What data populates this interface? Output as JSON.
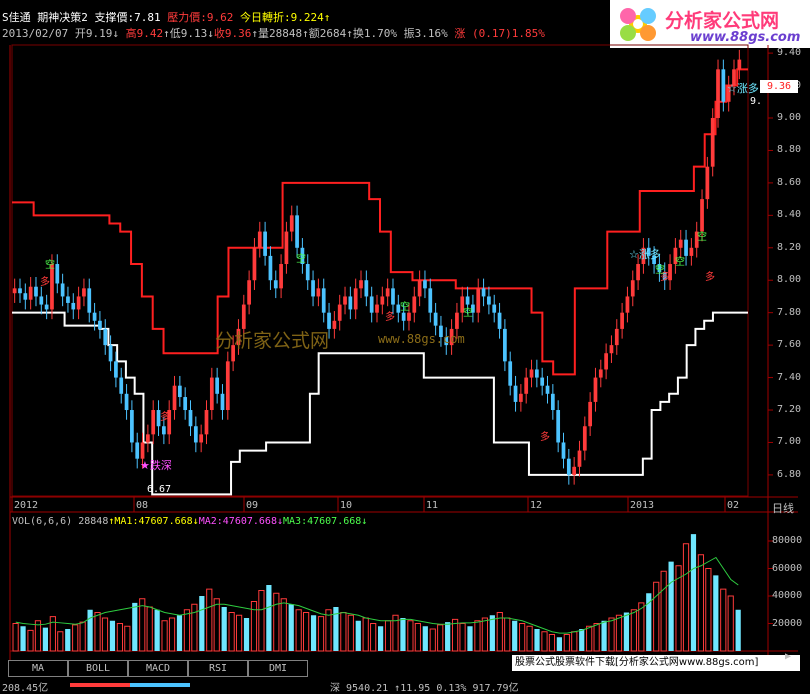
{
  "header": {
    "stock_name": "S佳通",
    "indicator": "期神决策2",
    "support_label": "支撑價:7.81",
    "pressure_label": "壓力價:9.62",
    "today_label": "今日轉折:9.224",
    "date": "2013/02/07",
    "open": "开9.19",
    "high": "高9.42",
    "low": "低9.13",
    "close": "收9.36",
    "volume": "量28848",
    "amount": "额2684",
    "turnover": "换1.70%",
    "amplitude": "振3.16%",
    "change": "涨 (0.17)1.85%"
  },
  "logo": {
    "title": "分析家公式网",
    "url": "www.88gs.com"
  },
  "watermark": {
    "title": "分析家公式网",
    "url": "www.88gs.com"
  },
  "price_axis": {
    "ticks": [
      "9.40",
      "9.20",
      "9.00",
      "8.80",
      "8.60",
      "8.40",
      "8.20",
      "8.00",
      "7.80",
      "7.60",
      "7.40",
      "7.20",
      "7.00",
      "6.80"
    ],
    "current_price": "9.36",
    "low_value": "6.67",
    "right_partial": "9."
  },
  "time_axis": {
    "labels": [
      "2012",
      "08",
      "09",
      "10",
      "11",
      "12",
      "2013",
      "02"
    ],
    "period": "日线"
  },
  "annotations": {
    "rise_label": "☆涨多",
    "fall_label": "★跌深",
    "buy_mark": "多",
    "sell_mark": "空"
  },
  "volume_header": {
    "name": "VOL(6,6,6)",
    "value": "28848",
    "ma1": "MA1:47607.668",
    "ma2": "MA2:47607.668",
    "ma3": "MA3:47607.668"
  },
  "volume_axis": {
    "ticks": [
      "80000",
      "60000",
      "40000",
      "20000"
    ]
  },
  "tabs": [
    "MA",
    "BOLL",
    "MACD",
    "RSI",
    "DMI"
  ],
  "banner": "股票公式股票软件下载[分析家公式网www.88gs.com]",
  "bottom_bar": {
    "left": "208.45亿",
    "middle": "深 9540.21 ↑11.95 0.13% 917.79亿"
  },
  "colors": {
    "up": "#ff3b3b",
    "down": "#4cc3ff",
    "support": "#ffffff",
    "pressure": "#ff2020",
    "ma": "#2ecc40"
  },
  "chart_data": {
    "type": "candlestick",
    "x_range": [
      "2012-07",
      "2013-02"
    ],
    "ylim": [
      6.67,
      9.45
    ],
    "close_series": [
      7.95,
      7.92,
      7.88,
      7.96,
      7.9,
      7.85,
      7.82,
      8.1,
      7.98,
      7.9,
      7.86,
      7.82,
      7.9,
      7.95,
      7.8,
      7.75,
      7.7,
      7.6,
      7.5,
      7.4,
      7.3,
      7.2,
      7.0,
      6.9,
      7.0,
      7.05,
      7.2,
      7.1,
      7.05,
      7.2,
      7.35,
      7.28,
      7.2,
      7.1,
      7.0,
      7.05,
      7.2,
      7.4,
      7.3,
      7.2,
      7.5,
      7.6,
      7.7,
      7.85,
      8.0,
      8.2,
      8.3,
      8.15,
      8.0,
      7.95,
      8.1,
      8.3,
      8.4,
      8.2,
      8.1,
      8.0,
      7.9,
      7.95,
      7.8,
      7.7,
      7.75,
      7.85,
      7.9,
      7.82,
      7.95,
      8.0,
      7.9,
      7.8,
      7.85,
      7.9,
      7.95,
      7.85,
      7.8,
      7.75,
      7.8,
      7.9,
      8.0,
      7.95,
      7.8,
      7.72,
      7.65,
      7.6,
      7.7,
      7.8,
      7.9,
      7.85,
      7.8,
      7.95,
      7.9,
      7.85,
      7.8,
      7.7,
      7.5,
      7.35,
      7.25,
      7.3,
      7.4,
      7.45,
      7.4,
      7.35,
      7.3,
      7.2,
      7.0,
      6.9,
      6.8,
      6.85,
      6.95,
      7.1,
      7.25,
      7.4,
      7.45,
      7.55,
      7.6,
      7.7,
      7.8,
      7.9,
      8.0,
      8.1,
      8.2,
      8.15,
      8.1,
      8.05,
      8.0,
      8.1,
      8.2,
      8.25,
      8.15,
      8.2,
      8.3,
      8.5,
      8.7,
      9.0,
      9.3,
      9.1,
      9.2,
      9.3,
      9.36
    ],
    "support_series": [
      7.8,
      7.8,
      7.8,
      7.8,
      7.8,
      7.8,
      7.72,
      7.72,
      7.72,
      7.72,
      7.7,
      7.6,
      7.5,
      7.4,
      7.3,
      7.0,
      6.68,
      6.68,
      6.68,
      6.68,
      6.68,
      6.68,
      6.68,
      6.68,
      6.68,
      6.88,
      6.95,
      6.95,
      6.95,
      7.0,
      7.0,
      7.0,
      7.0,
      7.0,
      7.3,
      7.55,
      7.55,
      7.55,
      7.55,
      7.55,
      7.55,
      7.55,
      7.55,
      7.55,
      7.55,
      7.55,
      7.55,
      7.4,
      7.4,
      7.4,
      7.4,
      7.4,
      7.4,
      7.4,
      7.4,
      7.0,
      7.0,
      7.0,
      7.0,
      6.8,
      6.8,
      6.8,
      6.8,
      6.8,
      6.8,
      6.8,
      6.8,
      6.8,
      6.8,
      6.8,
      6.8,
      6.8,
      6.9,
      7.2,
      7.25,
      7.3,
      7.4,
      7.6,
      7.7,
      7.75,
      7.8,
      7.8,
      7.8,
      7.8
    ],
    "pressure_series": [
      8.48,
      8.48,
      8.4,
      8.4,
      8.4,
      8.4,
      8.4,
      8.4,
      8.4,
      8.35,
      8.3,
      8.1,
      7.9,
      7.7,
      7.55,
      7.55,
      7.55,
      7.55,
      7.55,
      7.9,
      8.2,
      8.2,
      8.2,
      8.2,
      8.2,
      8.6,
      8.6,
      8.6,
      8.6,
      8.6,
      8.6,
      8.6,
      8.6,
      8.5,
      8.3,
      8.05,
      8.05,
      8.0,
      8.0,
      8.0,
      8.0,
      7.95,
      7.95,
      7.95,
      7.95,
      7.95,
      7.95,
      7.95,
      7.8,
      7.5,
      7.42,
      7.42,
      7.95,
      7.95,
      7.95,
      8.3,
      8.3,
      8.3,
      8.55,
      8.55,
      8.55,
      8.55,
      8.55,
      8.7,
      8.9,
      9.1,
      9.2,
      9.3
    ],
    "volume_series": [
      20000,
      18000,
      15000,
      22000,
      17000,
      25000,
      14000,
      16000,
      19000,
      21000,
      30000,
      28000,
      24000,
      22000,
      20000,
      18000,
      35000,
      38000,
      32000,
      30000,
      22000,
      24000,
      26000,
      30000,
      34000,
      40000,
      45000,
      38000,
      32000,
      28000,
      26000,
      24000,
      36000,
      44000,
      48000,
      42000,
      38000,
      34000,
      30000,
      28000,
      26000,
      25000,
      30000,
      32000,
      28000,
      26000,
      22000,
      24000,
      20000,
      18000,
      22000,
      26000,
      24000,
      22000,
      20000,
      18000,
      16000,
      19000,
      21000,
      23000,
      20000,
      18000,
      22000,
      24000,
      26000,
      28000,
      24000,
      22000,
      20000,
      18000,
      16000,
      14000,
      12000,
      10000,
      12000,
      14000,
      16000,
      18000,
      20000,
      22000,
      24000,
      26000,
      28000,
      30000,
      35000,
      42000,
      50000,
      58000,
      65000,
      62000,
      78000,
      85000,
      70000,
      60000,
      55000,
      45000,
      40000,
      30000
    ],
    "ma_series": [
      21000,
      20000,
      19500,
      19000,
      19500,
      21000,
      20500,
      20000,
      19500,
      20500,
      24000,
      26000,
      28000,
      29000,
      30000,
      31000,
      32000,
      33000,
      32000,
      30000,
      28000,
      27000,
      26000,
      27000,
      28000,
      30000,
      32000,
      34000,
      34000,
      33000,
      32000,
      31000,
      30000,
      30000,
      32000,
      34000,
      35000,
      34000,
      33000,
      31000,
      29000,
      27000,
      26000,
      27000,
      28000,
      27000,
      26000,
      24000,
      23000,
      22000,
      22000,
      22000,
      23000,
      23000,
      22000,
      21000,
      20000,
      19500,
      19500,
      20000,
      20500,
      20500,
      21000,
      22000,
      23000,
      24000,
      24000,
      23000,
      22000,
      20000,
      18000,
      16000,
      14000,
      13000,
      13000,
      14000,
      15000,
      17000,
      19000,
      21000,
      22000,
      24000,
      26000,
      28000,
      31000,
      35000,
      40000,
      45000,
      50000,
      53000,
      56000,
      60000,
      62000,
      65000,
      68000,
      60000,
      52000,
      48000
    ]
  }
}
